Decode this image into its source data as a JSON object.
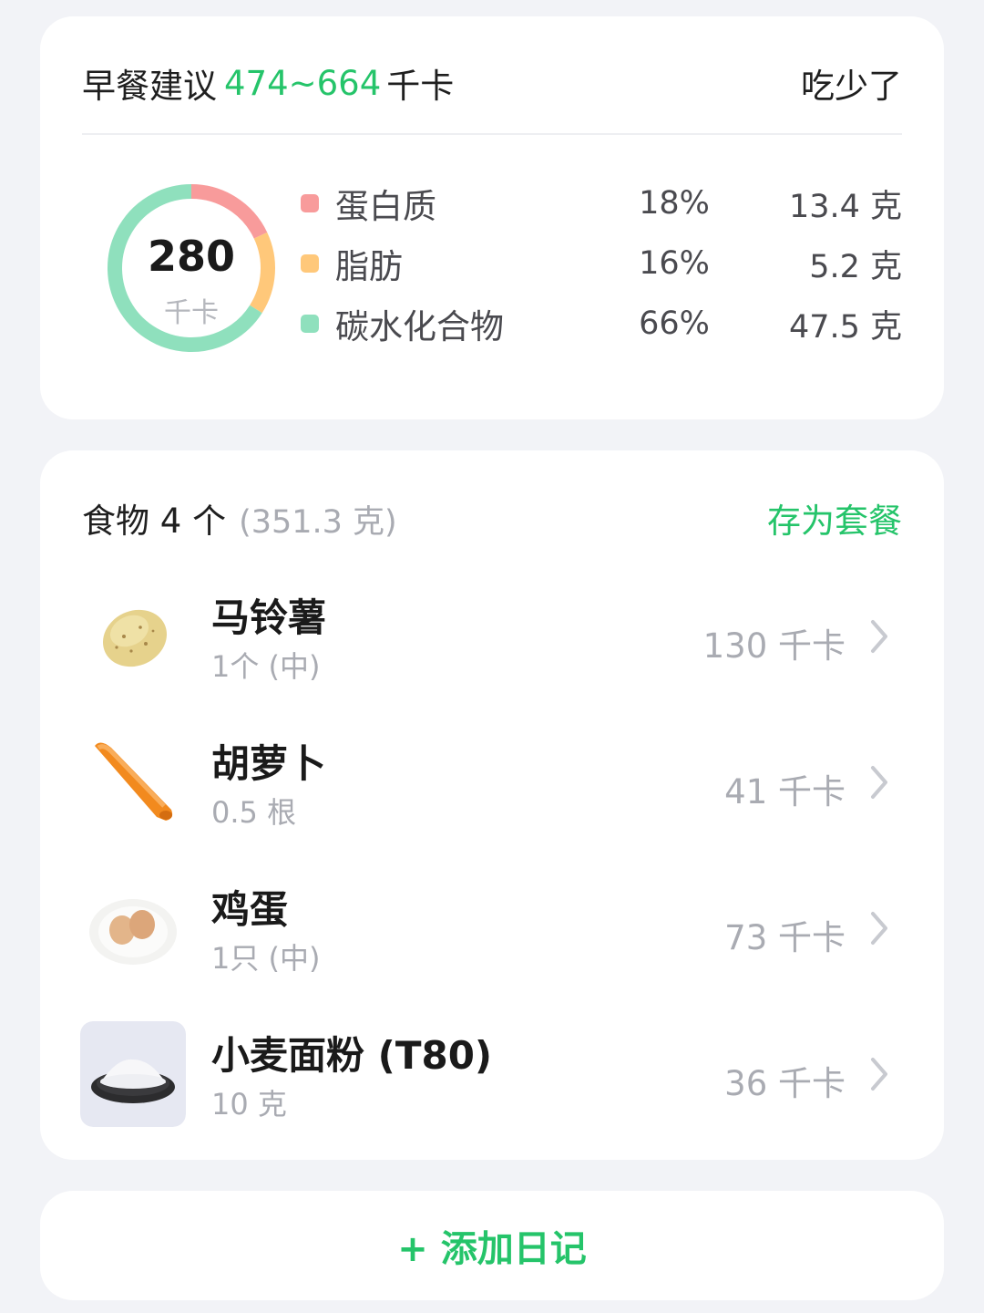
{
  "summary": {
    "title_prefix": "早餐建议",
    "range": "474~664",
    "title_unit": "千卡",
    "ate_less": "吃少了",
    "kcal": "280",
    "kcal_unit": "千卡",
    "macros": [
      {
        "name": "蛋白质",
        "pct": "18%",
        "grams": "13.4 克",
        "color": "#f89b9b",
        "fraction": 0.18
      },
      {
        "name": "脂肪",
        "pct": "16%",
        "grams": "5.2 克",
        "color": "#ffc87a",
        "fraction": 0.16
      },
      {
        "name": "碳水化合物",
        "pct": "66%",
        "grams": "47.5 克",
        "color": "#8fe0bd",
        "fraction": 0.66
      }
    ]
  },
  "foods": {
    "count_label": "食物 4 个",
    "total_weight": "(351.3 克)",
    "save_meal": "存为套餐",
    "items": [
      {
        "name": "马铃薯",
        "portion": "1个 (中)",
        "kcal": "130 千卡",
        "icon": "potato-icon"
      },
      {
        "name": "胡萝卜",
        "portion": "0.5 根",
        "kcal": "41 千卡",
        "icon": "carrot-icon"
      },
      {
        "name": "鸡蛋",
        "portion": "1只 (中)",
        "kcal": "73 千卡",
        "icon": "egg-icon"
      },
      {
        "name": "小麦面粉 (T80)",
        "portion": "10 克",
        "kcal": "36 千卡",
        "icon": "flour-icon"
      }
    ]
  },
  "add_diary": "+ 添加日记",
  "colors": {
    "accent": "#25c46a",
    "muted": "#a9abb2"
  }
}
